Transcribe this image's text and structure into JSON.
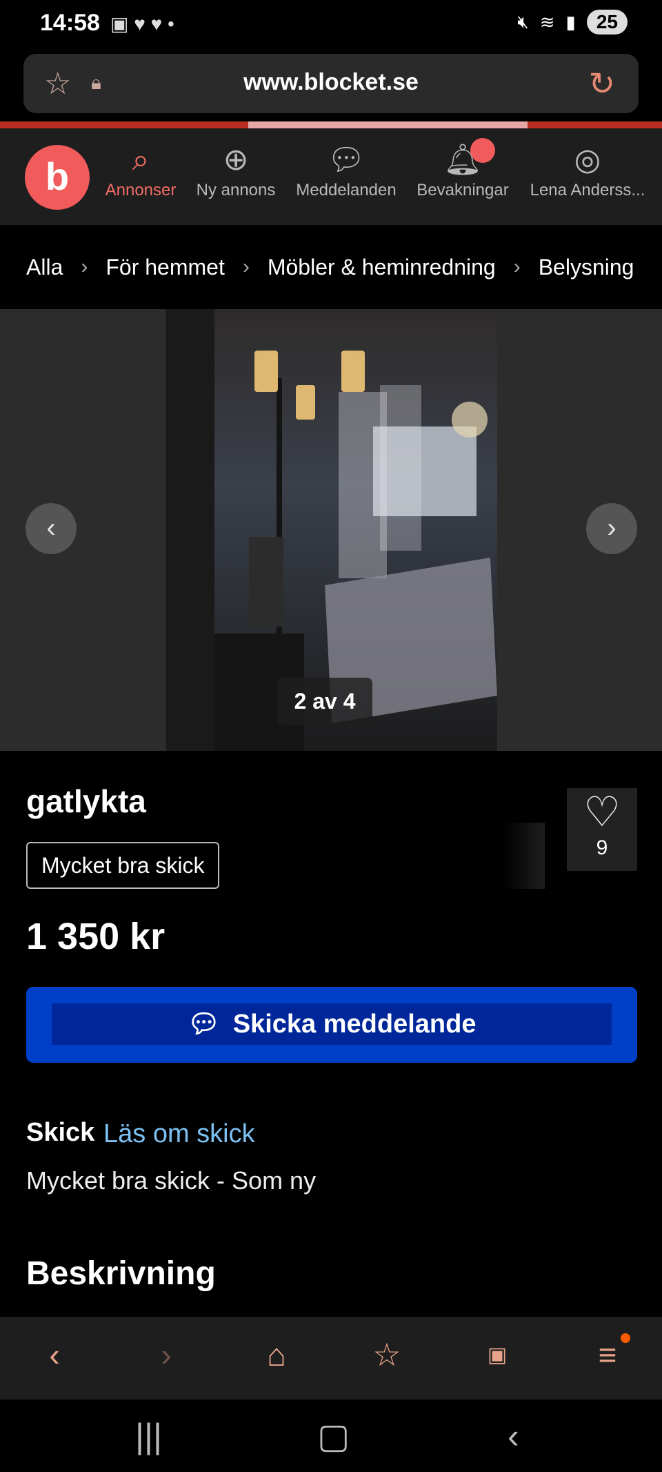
{
  "status": {
    "time": "14:58",
    "battery": "25"
  },
  "browser": {
    "url": "www.blocket.se"
  },
  "nav": {
    "logo": "b",
    "items": [
      {
        "label": "Annonser",
        "icon": "search-icon"
      },
      {
        "label": "Ny annons",
        "icon": "plus-circle-icon"
      },
      {
        "label": "Meddelanden",
        "icon": "chat-icon"
      },
      {
        "label": "Bevakningar",
        "icon": "bell-icon"
      },
      {
        "label": "Lena Anderss..."
      }
    ]
  },
  "breadcrumb": [
    "Alla",
    "För hemmet",
    "Möbler & heminredning",
    "Belysning"
  ],
  "gallery": {
    "counter": "2 av 4"
  },
  "listing": {
    "title": "gatlykta",
    "condition_tag": "Mycket bra skick",
    "favorites": "9",
    "price": "1 350 kr",
    "send_button": "Skicka meddelande",
    "skick_label": "Skick",
    "skick_link": "Läs om skick",
    "skick_value": "Mycket bra skick - Som ny",
    "description_heading": "Beskrivning"
  },
  "colors": {
    "accent": "#f15b5b",
    "button": "#0040c8",
    "link": "#7cc1f2"
  }
}
